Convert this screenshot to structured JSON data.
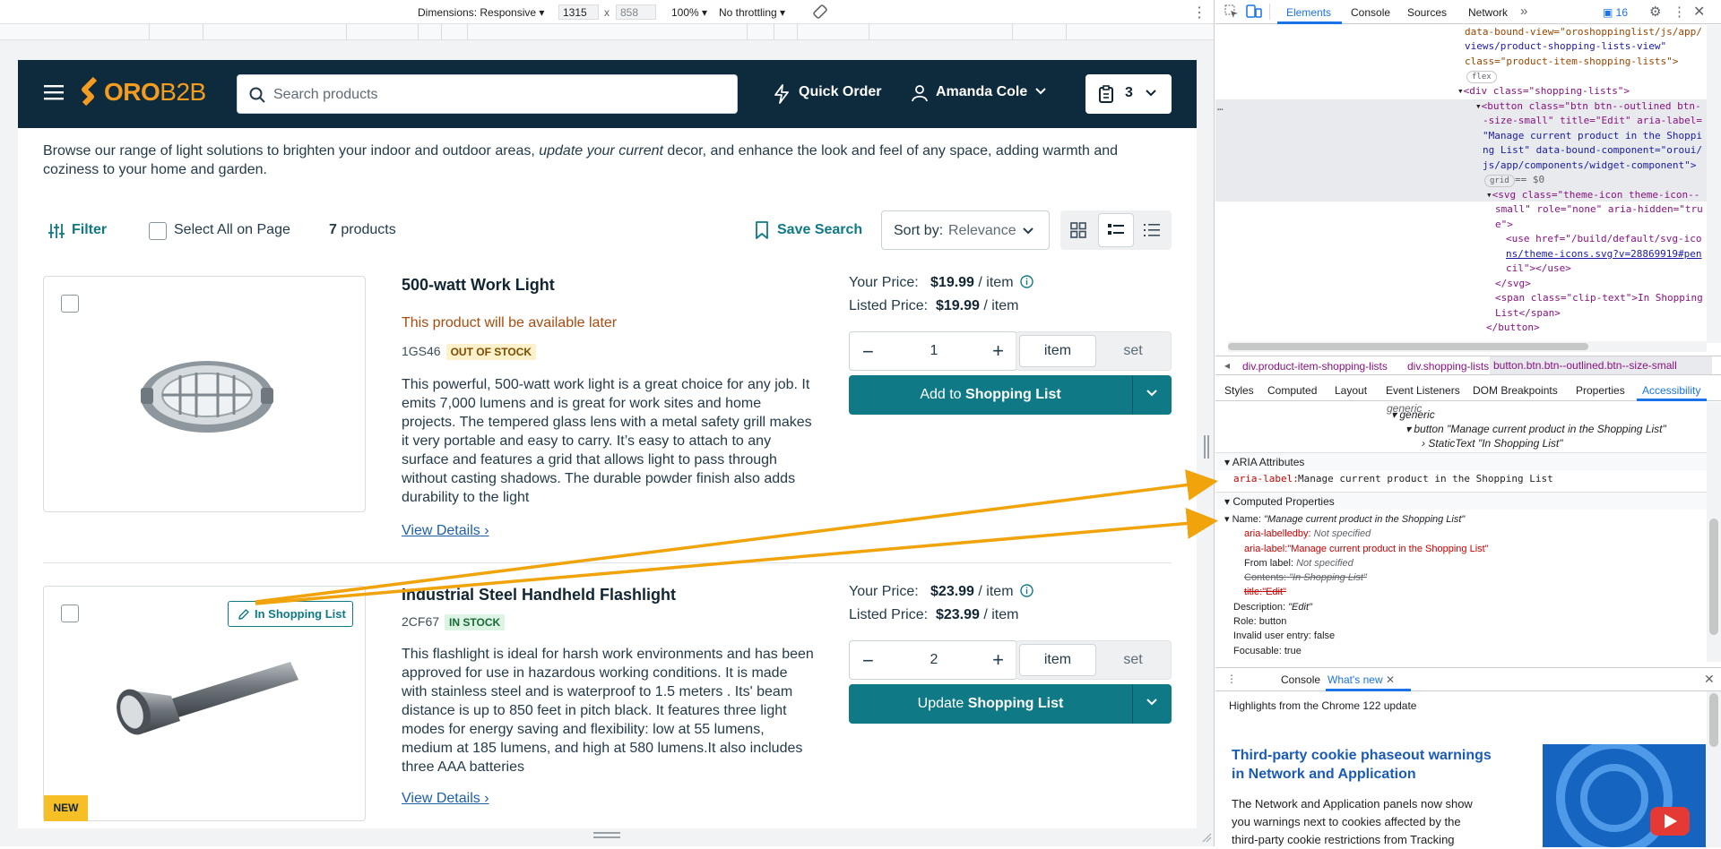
{
  "toolbar": {
    "dimensions_label": "Dimensions: Responsive",
    "width": "1315",
    "x": "x",
    "height": "858",
    "zoom": "100%",
    "throttle": "No throttling"
  },
  "site": {
    "logo_part1": "ORO",
    "logo_part2": "B2B",
    "search_placeholder": "Search products",
    "quick_order": "Quick Order",
    "user": "Amanda Cole",
    "lists_count": "3",
    "intro_1": "Browse our range of light solutions to brighten your indoor and outdoor areas, ",
    "intro_em": "update your current",
    "intro_2": " decor, and enhance the look and feel of any space, adding warmth and",
    "intro_3": "coziness to your home and garden.",
    "filter": "Filter",
    "select_all": "Select All on Page",
    "count_num": "7",
    "count_label": "products",
    "save_search": "Save Search",
    "sort_label": "Sort by:",
    "sort_value": "Relevance"
  },
  "products": [
    {
      "title": "500-watt Work Light",
      "availability": "This product will be available later",
      "sku": "1GS46",
      "stock": "OUT OF STOCK",
      "desc": [
        "This powerful, 500-watt work light is a great choice for any job. It",
        "emits 7,000 lumens and is great for work sites and home",
        "projects. The tempered glass lens with a metal safety grill makes",
        "it very portable and easy to carry. It’s easy to attach to any",
        "surface and features a grid that allows light to pass through",
        "without casting shadows. The durable powder finish also adds",
        "durability to the light"
      ],
      "view_details": "View Details",
      "your_price_label": "Your Price:",
      "your_price": "$19.99",
      "per": "/ item",
      "listed_label": "Listed Price:",
      "listed_price": "$19.99",
      "qty": "1",
      "unit_item": "item",
      "unit_set": "set",
      "btn_prefix": "Add to ",
      "btn_bold": "Shopping List"
    },
    {
      "title": "Industrial Steel Handheld Flashlight",
      "sku": "2CF67",
      "stock": "IN STOCK",
      "in_list": "In Shopping List",
      "new_badge": "NEW",
      "desc": [
        "This flashlight is ideal for harsh work environments and has been",
        "approved for use in hazardous working conditions. It is made",
        "with stainless steel and is waterproof to 1.5 meters . Its' beam",
        "distance is up to 850 feet in pitch black. It features three light",
        "modes for energy saving and flexibility: low at 55 lumens,",
        "medium at 185 lumens, and high at 580 lumens.It also includes",
        "three AAA batteries"
      ],
      "view_details": "View Details",
      "your_price_label": "Your Price:",
      "your_price": "$23.99",
      "per": "/ item",
      "listed_label": "Listed Price:",
      "listed_price": "$23.99",
      "qty": "2",
      "unit_item": "item",
      "unit_set": "set",
      "btn_prefix": "Update ",
      "btn_bold": "Shopping List"
    }
  ],
  "devtools": {
    "tabs": [
      "Elements",
      "Console",
      "Sources",
      "Network"
    ],
    "issues": "16",
    "tree": [
      "data-bound-view=\"oroshoppinglist/js/app/",
      "views/product-shopping-lists-view\"",
      "class=\"product-item-shopping-lists\">",
      "flex",
      "<div class=\"shopping-lists\">",
      "<button class=\"btn btn--outlined btn-",
      "-size-small\" title=\"Edit\" aria-label=",
      "\"Manage current product in the Shoppi",
      "ng List\" data-bound-component=\"oroui/",
      "js/app/components/widget-component\">",
      "grid",
      "== $0",
      "<svg class=\"theme-icon theme-icon--",
      "small\" role=\"none\" aria-hidden=\"tru",
      "e\">",
      "<use href=\"/build/default/svg-ico",
      "ns/theme-icons.svg?v=28869919#pen",
      "cil\"></use>",
      "</svg>",
      "<span class=\"clip-text\">In Shopping",
      "List</span>",
      "</button>"
    ],
    "breadcrumbs": [
      "div.product-item-shopping-lists",
      "div.shopping-lists",
      "button.btn.btn--outlined.btn--size-small"
    ],
    "subtabs": [
      "Styles",
      "Computed",
      "Layout",
      "Event Listeners",
      "DOM Breakpoints",
      "Properties",
      "Accessibility"
    ],
    "acc": {
      "tree_generic1": "generic",
      "tree_generic2": "generic",
      "tree_button": "button",
      "tree_button_name": "\"Manage current product in the Shopping List\"",
      "tree_static": "StaticText",
      "tree_static_name": "\"In Shopping List\"",
      "aria_header": "ARIA Attributes",
      "aria_label_key": "aria-label:",
      "aria_label_val": "Manage current product in the Shopping List",
      "computed_header": "Computed Properties",
      "name_key": "Name:",
      "name_val": "\"Manage current product in the Shopping List\"",
      "labelledby_key": "aria-labelledby:",
      "labelledby_val": "Not specified",
      "arialabel_key": "aria-label:",
      "arialabel_val": "\"Manage current product in the Shopping List\"",
      "fromlabel_key": "From label:",
      "fromlabel_val": "Not specified",
      "contents_key": "Contents:",
      "contents_val": "\"In Shopping List\"",
      "title_key": "title:",
      "title_val": "\"Edit\"",
      "desc_key": "Description:",
      "desc_val": "\"Edit\"",
      "role_key": "Role:",
      "role_val": "button",
      "invalid_key": "Invalid user entry:",
      "invalid_val": "false",
      "focus_key": "Focusable:",
      "focus_val": "true"
    },
    "drawer": {
      "tab_console": "Console",
      "tab_whatsnew": "What's new",
      "highlights": "Highlights from the Chrome 122 update",
      "article_title_1": "Third-party cookie phaseout warnings",
      "article_title_2": "in Network and Application",
      "article_body": [
        "The Network and Application panels now show",
        "you warnings next to cookies affected by the",
        "third-party cookie restrictions from Tracking"
      ]
    }
  },
  "colors": {
    "header_bg": "#0e2a3d",
    "brand_orange": "#f39c1f",
    "primary_teal": "#0f7a85",
    "arrow": "#f0a30a",
    "devtools_blue": "#1a73e8"
  }
}
